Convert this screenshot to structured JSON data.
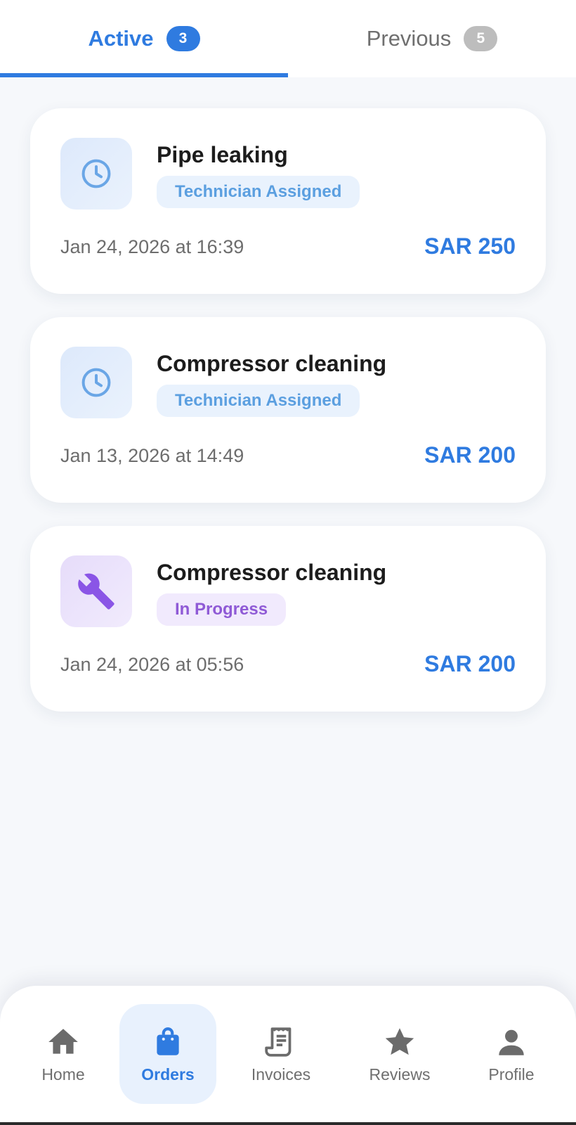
{
  "tabs": [
    {
      "label": "Active",
      "count": "3",
      "selected": true
    },
    {
      "label": "Previous",
      "count": "5",
      "selected": false
    }
  ],
  "orders": [
    {
      "title": "Pipe leaking",
      "status": "Technician Assigned",
      "date": "Jan 24, 2026 at 16:39",
      "price": "SAR 250",
      "icon": "clock-icon"
    },
    {
      "title": "Compressor cleaning",
      "status": "Technician Assigned",
      "date": "Jan 13, 2026 at 14:49",
      "price": "SAR 200",
      "icon": "clock-icon"
    },
    {
      "title": "Compressor cleaning",
      "status": "In Progress",
      "date": "Jan 24, 2026 at 05:56",
      "price": "SAR 200",
      "icon": "wrench-icon"
    }
  ],
  "nav": [
    {
      "label": "Home",
      "icon": "home-icon",
      "active": false
    },
    {
      "label": "Orders",
      "icon": "shopping-bag-icon",
      "active": true
    },
    {
      "label": "Invoices",
      "icon": "receipt-icon",
      "active": false
    },
    {
      "label": "Reviews",
      "icon": "star-icon",
      "active": false
    },
    {
      "label": "Profile",
      "icon": "person-icon",
      "active": false
    }
  ],
  "colors": {
    "accent": "#2f7be0",
    "status_assigned_bg": "#e9f2fd",
    "status_assigned_text": "#5b9fe0",
    "status_progress_bg": "#f1eafd",
    "status_progress_text": "#8f5ad6",
    "background": "#f6f8fb"
  }
}
